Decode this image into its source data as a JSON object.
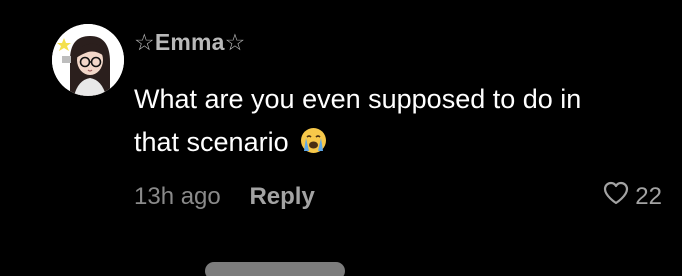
{
  "comment": {
    "username": "☆Emma☆",
    "text": "What are you even supposed to do in that scenario",
    "emoji": "loudly-crying-face-emoji",
    "time": "13h ago",
    "reply_label": "Reply",
    "like_count": "22",
    "like_icon": "heart-outline-icon"
  },
  "colors": {
    "background": "#000000",
    "username": "#b9b9b9",
    "text": "#ffffff",
    "meta": "#8a8a8a",
    "emoji_face": "#f7c84a",
    "emoji_tears": "#5fa8e8"
  }
}
